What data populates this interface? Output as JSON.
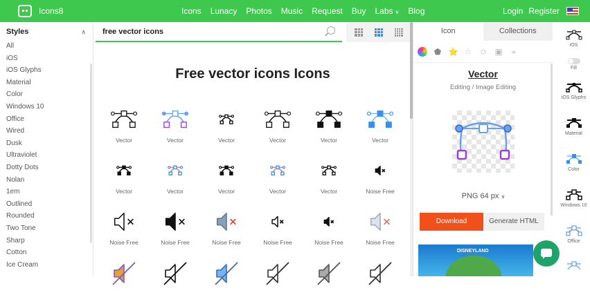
{
  "header": {
    "brand": "Icons8",
    "nav": [
      "Icons",
      "Lunacy",
      "Photos",
      "Music",
      "Request",
      "Buy",
      "Labs",
      "Blog"
    ],
    "login": "Login",
    "register": "Register",
    "accent": "#3ec84d"
  },
  "sidebar": {
    "title": "Styles",
    "items": [
      "All",
      "iOS",
      "iOS Glyphs",
      "Material",
      "Color",
      "Windows 10",
      "Office",
      "Wired",
      "Dusk",
      "Ultraviolet",
      "Dotty Dots",
      "Nolan",
      "1em",
      "Outlined",
      "Rounded",
      "Two Tone",
      "Sharp",
      "Cotton",
      "Ice Cream"
    ]
  },
  "search": {
    "value": "free vector icons"
  },
  "main": {
    "title": "Free vector icons Icons",
    "icons": [
      {
        "label": "Vector",
        "icon": "vector-outline-icon",
        "style": "outline"
      },
      {
        "label": "Vector",
        "icon": "vector-color-icon",
        "style": "purple"
      },
      {
        "label": "Vector",
        "icon": "vector-small-icon",
        "style": "small"
      },
      {
        "label": "Vector",
        "icon": "vector-ios-icon",
        "style": "outline"
      },
      {
        "label": "Vector",
        "icon": "vector-filled-icon",
        "style": "filled"
      },
      {
        "label": "Vector",
        "icon": "vector-blue-icon",
        "style": "blue"
      },
      {
        "label": "Vector",
        "icon": "vector-tiny-icon",
        "style": "smallfill"
      },
      {
        "label": "Vector",
        "icon": "vector-lightblue-icon",
        "style": "smallblue"
      },
      {
        "label": "Vector",
        "icon": "vector-glyph-icon",
        "style": "smallfill"
      },
      {
        "label": "Vector",
        "icon": "vector-thin-icon",
        "style": "smallblue"
      },
      {
        "label": "Vector",
        "icon": "vector-bold-icon",
        "style": "small"
      },
      {
        "label": "Noise Free",
        "icon": "speaker-mute-icon",
        "style": "mute-small"
      },
      {
        "label": "Noise Free",
        "icon": "speaker-x-outline-icon",
        "style": "mute-outline"
      },
      {
        "label": "Noise Free",
        "icon": "speaker-x-filled-icon",
        "style": "mute-filled"
      },
      {
        "label": "Noise Free",
        "icon": "speaker-x-color-icon",
        "style": "mute-color"
      },
      {
        "label": "Noise Free",
        "icon": "speaker-x-thin-icon",
        "style": "mute-thin"
      },
      {
        "label": "Noise Free",
        "icon": "speaker-x-glyph-icon",
        "style": "mute-glyph"
      },
      {
        "label": "Noise Free",
        "icon": "speaker-x-light-icon",
        "style": "mute-light"
      },
      {
        "label": "",
        "icon": "speaker-slash-color-icon",
        "style": "slash-color"
      },
      {
        "label": "",
        "icon": "speaker-slash-outline-icon",
        "style": "slash-outline"
      },
      {
        "label": "",
        "icon": "speaker-slash-blue-icon",
        "style": "slash-blue"
      },
      {
        "label": "",
        "icon": "speaker-slash-thin-icon",
        "style": "slash-thin"
      },
      {
        "label": "",
        "icon": "speaker-slash-gray-icon",
        "style": "slash-gray"
      },
      {
        "label": "",
        "icon": "speaker-slash-light-icon",
        "style": "slash-thin"
      }
    ]
  },
  "panel": {
    "tabs": [
      "Icon",
      "Collections"
    ],
    "icon_name": "Vector",
    "category": "Editing / Image Editing",
    "format": "PNG 64 px",
    "download": "Download",
    "generate_html": "Generate HTML",
    "promo_brand": "DISNEYLAND",
    "download_color": "#f1501b"
  },
  "rail": {
    "items": [
      "iOS",
      "Fill",
      "iOS Glyphs",
      "Material",
      "Color",
      "Windows 10",
      "Office"
    ]
  }
}
